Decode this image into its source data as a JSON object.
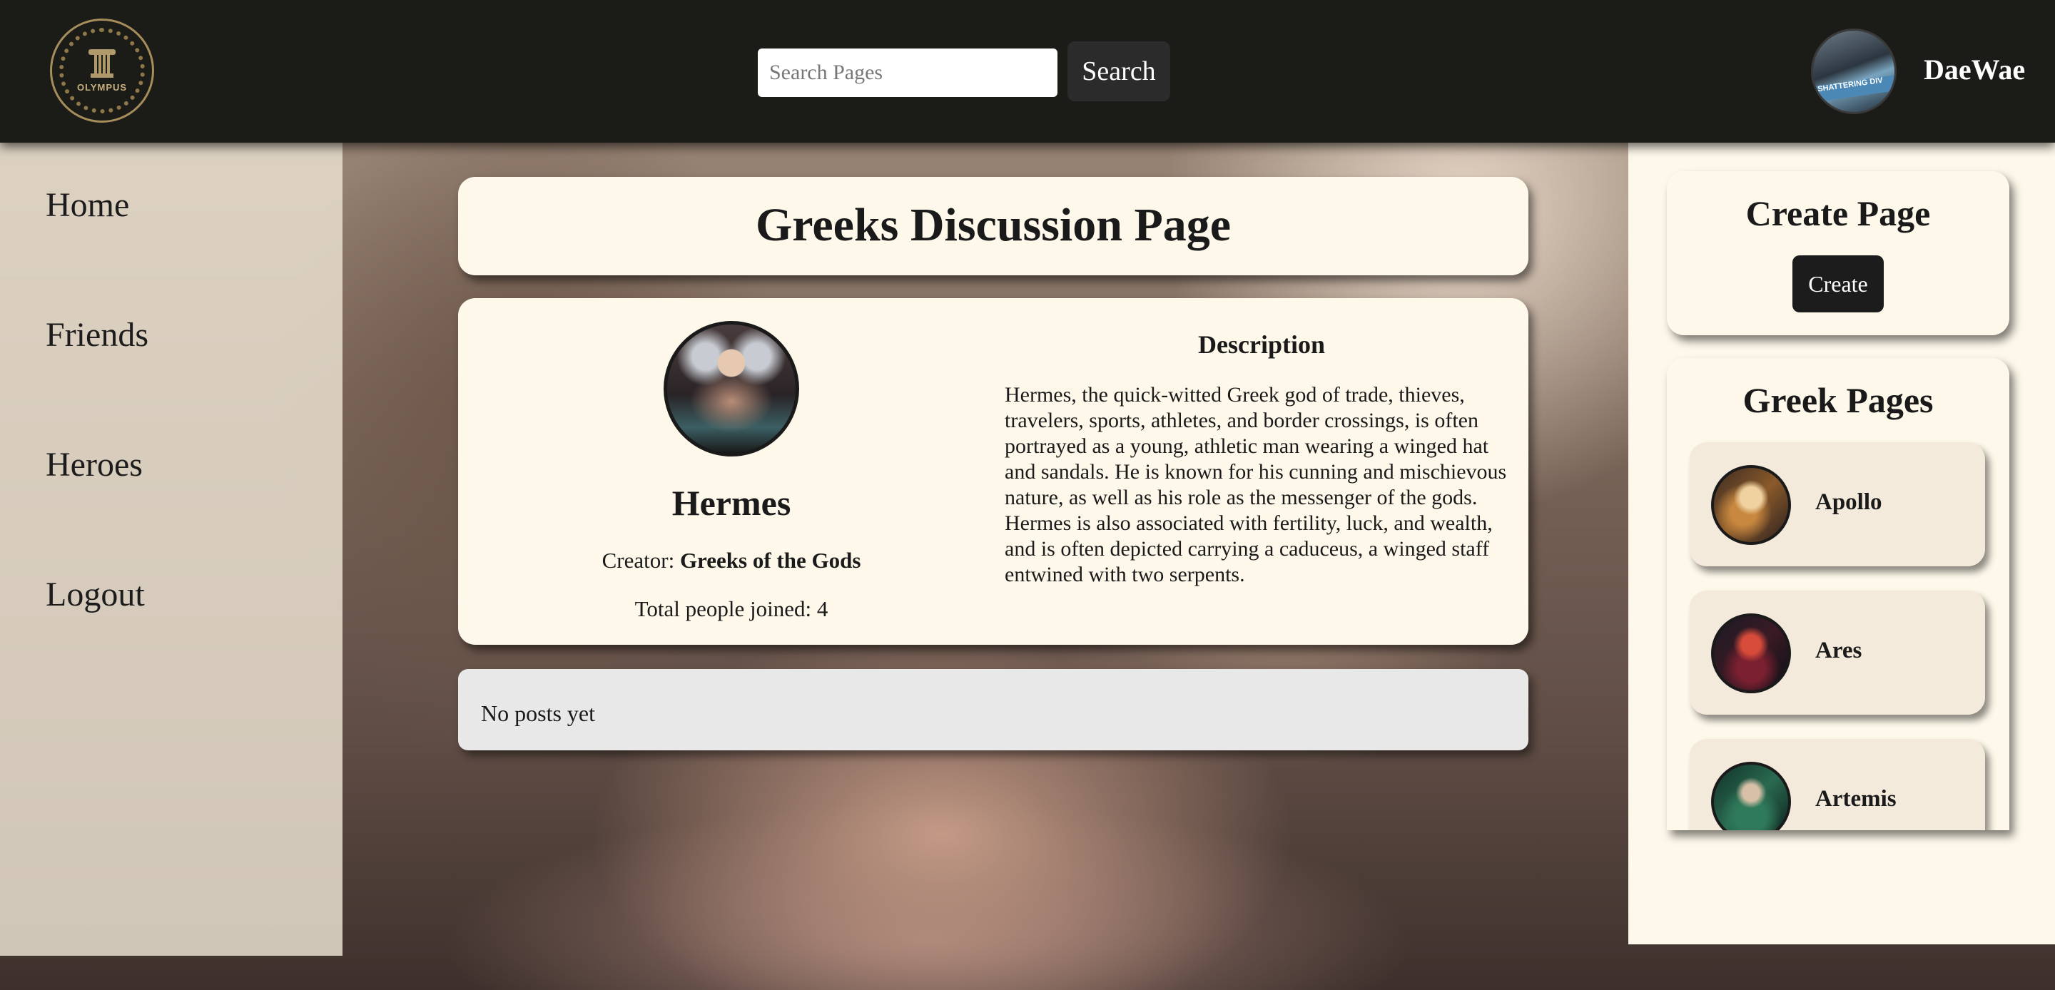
{
  "header": {
    "logo_text": "OLYMPUS",
    "search_placeholder": "Search Pages",
    "search_button": "Search",
    "avatar_text": "SHATTERING DIV",
    "username": "DaeWae"
  },
  "sidebar": {
    "items": [
      {
        "label": "Home"
      },
      {
        "label": "Friends"
      },
      {
        "label": "Heroes"
      },
      {
        "label": "Logout"
      }
    ]
  },
  "main": {
    "page_title": "Greeks Discussion Page",
    "hero": {
      "name": "Hermes",
      "creator_prefix": "Creator:",
      "creator_name": "Greeks of the Gods",
      "joined": "Total people joined: 4"
    },
    "description": {
      "title": "Description",
      "text": "Hermes, the quick-witted Greek god of trade, thieves, travelers, sports, athletes, and border crossings, is often portrayed as a young, athletic man wearing a winged hat and sandals. He is known for his cunning and mischievous nature, as well as his role as the messenger of the gods. Hermes is also associated with fertility, luck, and wealth, and is often depicted carrying a caduceus, a winged staff entwined with two serpents."
    },
    "posts_empty": "No posts yet"
  },
  "right_panel": {
    "create_title": "Create Page",
    "create_button": "Create",
    "pages_title": "Greek Pages",
    "pages": [
      {
        "name": "Apollo"
      },
      {
        "name": "Ares"
      },
      {
        "name": "Artemis"
      }
    ]
  },
  "colors": {
    "header_bg": "#1b1b17",
    "card_bg": "#fdf8ea",
    "sidebar_bg": "#e8dece",
    "button_bg": "#1c1c1c"
  }
}
